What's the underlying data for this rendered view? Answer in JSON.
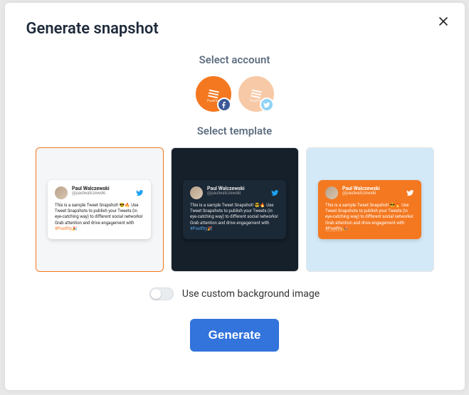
{
  "modal": {
    "title": "Generate snapshot",
    "select_account_label": "Select account",
    "select_template_label": "Select template",
    "toggle_label": "Use custom background image",
    "generate_label": "Generate"
  },
  "accounts": [
    {
      "platform": "facebook",
      "selected": true
    },
    {
      "platform": "twitter",
      "selected": false
    }
  ],
  "tweet_sample": {
    "name": "Paul Walczewski",
    "handle": "@paulwalczewski",
    "text_prefix": "This is a sample Tweet Snapshot! 😎🔥 Use Tweet Snapshots to publish your Tweets (in eye-catching way) to different social networks! Grab attention and drive engagement with ",
    "hashtag": "#Postfity",
    "text_suffix": "🎉"
  },
  "templates": [
    {
      "variant": "light",
      "selected": true
    },
    {
      "variant": "dark",
      "selected": false
    },
    {
      "variant": "orange",
      "selected": false
    }
  ]
}
